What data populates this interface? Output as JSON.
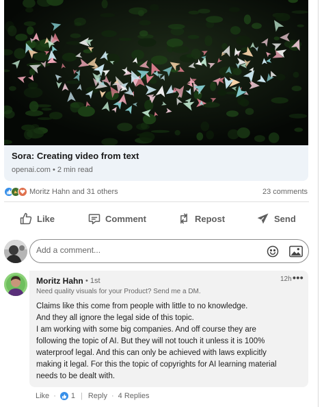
{
  "article": {
    "title": "Sora: Creating video from text",
    "source": "openai.com",
    "read_time": "2 min read"
  },
  "social": {
    "reactors": "Moritz Hahn and 31 others",
    "comments": "23 comments"
  },
  "actions": {
    "like": "Like",
    "comment": "Comment",
    "repost": "Repost",
    "send": "Send"
  },
  "composer": {
    "placeholder": "Add a comment..."
  },
  "comment": {
    "author": "Moritz Hahn",
    "degree": "1st",
    "headline": "Need quality visuals for your Product? Send me a DM.",
    "time": "12h",
    "more": "•••",
    "body": [
      "Claims like this come from people with little to no knowledge.",
      "And they all ignore the legal side of this topic.",
      "I am working with some big companies. And off course they are",
      "following the topic of AI. But they will not touch it unless it is 100%",
      "waterproof legal. And this can only be achieved with laws explicitly",
      "making it legal. For this the topic of copyrights for AI learning material",
      "needs to be dealt with."
    ],
    "like_label": "Like",
    "like_count": "1",
    "reply_label": "Reply",
    "replies": "4 Replies"
  },
  "icons": [
    "like-icon",
    "comment-icon",
    "repost-icon",
    "send-icon",
    "emoji-icon",
    "image-icon",
    "more-icon"
  ],
  "colors": {
    "like_blue": "#378fe9",
    "article_panel": "#eef3f8",
    "comment_bubble": "#f2f2f2"
  }
}
